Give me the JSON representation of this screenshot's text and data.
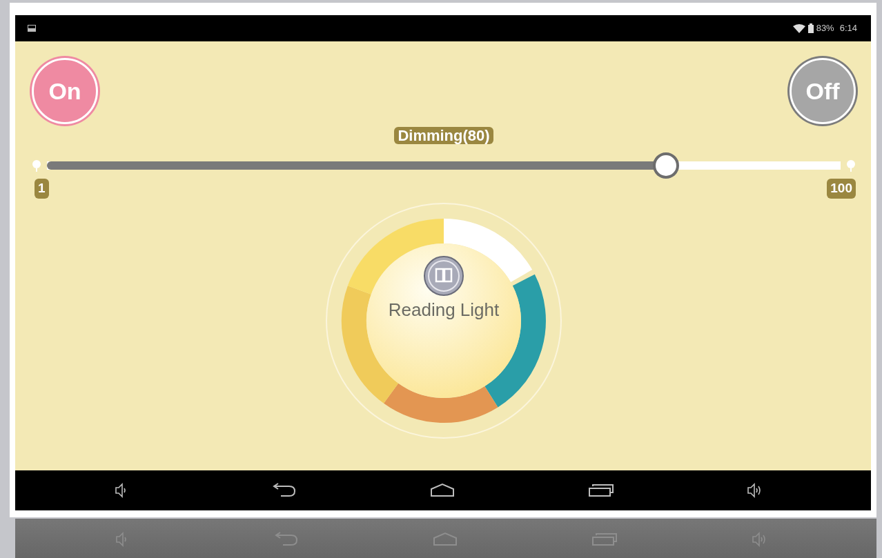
{
  "status_bar": {
    "battery": "83%",
    "time": "6:14"
  },
  "power_buttons": [
    {
      "label": "On",
      "kind": "on"
    },
    {
      "label": "Off",
      "kind": "off"
    }
  ],
  "dimming": {
    "label": "Dimming(80)",
    "level": 0.79,
    "min": "1",
    "max": "100"
  },
  "mode": {
    "label": "Reading Light"
  }
}
